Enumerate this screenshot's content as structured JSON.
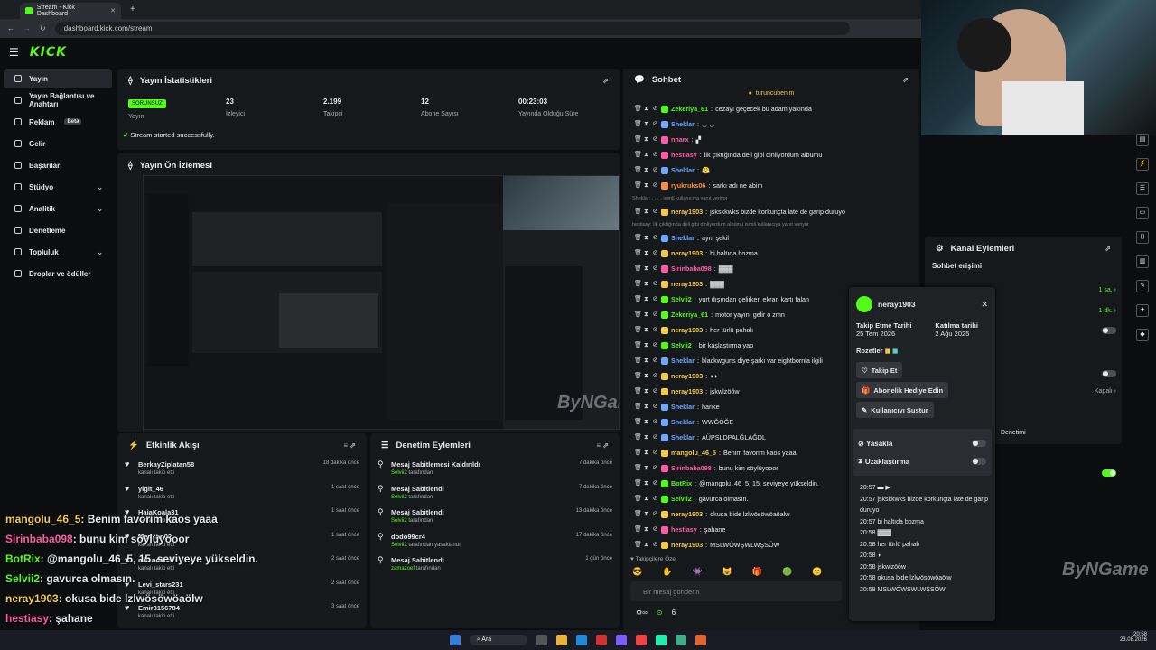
{
  "browser": {
    "tab_title": "Stream - Kick Dashboard",
    "url": "dashboard.kick.com/stream"
  },
  "brand": {
    "logo": "KICK",
    "accent": "#53fc18"
  },
  "sidebar": {
    "items": [
      {
        "label": "Yayın",
        "icon": "broadcast-icon",
        "active": true
      },
      {
        "label": "Yayın Bağlantısı ve Anahtarı",
        "icon": "link-icon"
      },
      {
        "label": "Reklam",
        "icon": "ad-icon",
        "badge": "Beta"
      },
      {
        "label": "Gelir",
        "icon": "money-icon"
      },
      {
        "label": "Başarılar",
        "icon": "trophy-icon"
      },
      {
        "label": "Stüdyo",
        "icon": "studio-icon",
        "chevron": true
      },
      {
        "label": "Analitik",
        "icon": "chart-icon",
        "chevron": true
      },
      {
        "label": "Denetleme",
        "icon": "shield-icon"
      },
      {
        "label": "Topluluk",
        "icon": "community-icon",
        "chevron": true
      },
      {
        "label": "Droplar ve ödüller",
        "icon": "gift-icon"
      }
    ]
  },
  "stats": {
    "title": "Yayın İstatistikleri",
    "status": "SORUNSUZ",
    "status_label": "Yayın",
    "items": [
      {
        "value": "23",
        "label": "İzleyici"
      },
      {
        "value": "2.199",
        "label": "Takipçi"
      },
      {
        "value": "12",
        "label": "Abone Sayısı"
      },
      {
        "value": "00:23:03",
        "label": "Yayında Olduğu Süre"
      }
    ],
    "message": "Stream started successfully."
  },
  "preview": {
    "title": "Yayın Ön İzlemesi",
    "watermark": "ByNGame"
  },
  "activity": {
    "title": "Etkinlik Akışı",
    "items": [
      {
        "name": "BerkayZiplatan58",
        "sub": "kanalı takip etti",
        "time": "18 dakika önce"
      },
      {
        "name": "yigit_46",
        "sub": "kanalı takip etti",
        "time": "1 saat önce"
      },
      {
        "name": "HaiaKoala31",
        "sub": "kanalı takip etti",
        "time": "1 saat önce"
      },
      {
        "name": "Mertcan02",
        "sub": "kanalı takip etti",
        "time": "1 saat önce"
      },
      {
        "name": "milandadd",
        "sub": "kanalı takip etti",
        "time": "2 saat önce"
      },
      {
        "name": "Levi_stars231",
        "sub": "kanalı takip etti",
        "time": "2 saat önce"
      },
      {
        "name": "Emir3156784",
        "sub": "kanalı takip etti",
        "time": "3 saat önce"
      }
    ]
  },
  "mod": {
    "title": "Denetim Eylemleri",
    "items": [
      {
        "title": "Mesaj Sabitlemesi Kaldırıldı",
        "by": "Selvii2",
        "sub": "tarafından",
        "time": "7 dakika önce"
      },
      {
        "title": "Mesaj Sabitlendi",
        "by": "Selvii2",
        "sub": "tarafından",
        "time": "7 dakika önce"
      },
      {
        "title": "Mesaj Sabitlendi",
        "by": "Selvii2",
        "sub": "tarafından",
        "time": "13 dakika önce"
      },
      {
        "title": "dodo99cr4",
        "by": "Selvii2",
        "sub": "tarafından yasaklandı",
        "time": "17 dakika önce"
      },
      {
        "title": "Mesaj Sabitlendi",
        "by": "zamazoef",
        "sub": "tarafından",
        "time": "1 gün önce"
      }
    ]
  },
  "chat": {
    "title": "Sohbet",
    "pinned_user": "turuncubenim",
    "input_placeholder": "Bir mesaj gönderin",
    "followers_only": "Takipçilere Özel",
    "viewer_count": "6",
    "messages": [
      {
        "user": "Zekeriya_61",
        "color": "#53fc18",
        "text": "cezayı geçecek bu adam yakında"
      },
      {
        "user": "Sheklar",
        "color": "#6fa8ff",
        "text": "◡ ◡"
      },
      {
        "user": "nnarx",
        "color": "#ff5aa5",
        "text": "▞"
      },
      {
        "user": "hestiasy",
        "color": "#ff5aa5",
        "text": "ilk çıktığında deli gibi dinliyordum albümü"
      },
      {
        "user": "Sheklar",
        "color": "#6fa8ff",
        "text": "😤"
      },
      {
        "user": "ryukruks06",
        "color": "#ff8c3a",
        "text": "sarkı adı ne abim"
      },
      {
        "sys": "Sheklar: ◡ ◡ isimli kullanıcıya yanıt veriyor"
      },
      {
        "user": "neray1903",
        "color": "#f2c94c",
        "text": "jskskkwks bizde korkunçta late de garip duruyo"
      },
      {
        "sys": "hestiasy: ilk çıktığında deli gibi dinliyordum albümü isimli kullanıcıya yanıt veriyor"
      },
      {
        "user": "Sheklar",
        "color": "#6fa8ff",
        "text": "aynı şekil"
      },
      {
        "user": "neray1903",
        "color": "#f2c94c",
        "text": "bi haltıda bozma"
      },
      {
        "user": "Sirinbaba098",
        "color": "#ff5aa5",
        "text": "▓▓▓"
      },
      {
        "user": "neray1903",
        "color": "#f2c94c",
        "text": "▓▓▓"
      },
      {
        "user": "Selvii2",
        "color": "#53fc18",
        "text": "yurt dışından gelirken ekran kartı falan"
      },
      {
        "user": "Zekeriya_61",
        "color": "#53fc18",
        "text": "motor yayını gelir o zmn"
      },
      {
        "user": "neray1903",
        "color": "#f2c94c",
        "text": "her türlü pahalı"
      },
      {
        "user": "Selvii2",
        "color": "#53fc18",
        "text": "bir kaşlaştırma yap"
      },
      {
        "user": "Sheklar",
        "color": "#6fa8ff",
        "text": "blackwguns diye şarkı var eightbornla ilgili"
      },
      {
        "user": "neray1903",
        "color": "#f2c94c",
        "text": "◗◗"
      },
      {
        "user": "neray1903",
        "color": "#f2c94c",
        "text": "jskwlzöõw"
      },
      {
        "user": "Sheklar",
        "color": "#6fa8ff",
        "text": "harike"
      },
      {
        "user": "Sheklar",
        "color": "#6fa8ff",
        "text": "WWĞÖĞE"
      },
      {
        "user": "Sheklar",
        "color": "#6fa8ff",
        "text": "AÜPSLDPALĞLAĞDL"
      },
      {
        "user": "mangolu_46_5",
        "color": "#f2c94c",
        "text": "Benim favorim kaos yaaa"
      },
      {
        "user": "Sirinbaba098",
        "color": "#ff5aa5",
        "text": "bunu kim söylüyooor"
      },
      {
        "user": "BotRix",
        "color": "#53fc18",
        "text": "@mangolu_46_5, 15. seviyeye yükseldin."
      },
      {
        "user": "Selvii2",
        "color": "#53fc18",
        "text": "gavurca olmasın."
      },
      {
        "user": "neray1903",
        "color": "#f2c94c",
        "text": "okusa bide lzlwösöwöaöalw"
      },
      {
        "user": "hestiasy",
        "color": "#ff5aa5",
        "text": "şahane"
      },
      {
        "user": "neray1903",
        "color": "#f2c94c",
        "text": "MSLWÖWŞWLWŞSÖW"
      }
    ]
  },
  "overlay": [
    {
      "user": "mangolu_46_5",
      "color": "#f2c94c",
      "text": ": Benim favorim kaos yaaa"
    },
    {
      "user": "Sirinbaba098",
      "color": "#ff5aa5",
      "text": ": bunu kim söylüyooor"
    },
    {
      "user": "BotRix",
      "color": "#53fc18",
      "text": ": @mangolu_46_5, 15. seviyeye yükseldin."
    },
    {
      "user": "Selvii2",
      "color": "#53fc18",
      "text": ": gavurca olmasın."
    },
    {
      "user": "neray1903",
      "color": "#f2c94c",
      "text": ": okusa bide lzlwösöwöaölw"
    },
    {
      "user": "hestiasy",
      "color": "#ff5aa5",
      "text": ": şahane"
    },
    {
      "user": "neray1903",
      "color": "#f2c94c",
      "text": ": MSLWÖWŞWLWŞSÖW"
    }
  ],
  "channel_actions": {
    "title": "Kanal Eylemleri",
    "chat_access": "Sohbet erişimi",
    "values": [
      "1 sa.",
      "1 dk.",
      "Kapalı"
    ],
    "label_denetimi": "Denetimi"
  },
  "user_card": {
    "name": "neray1903",
    "follow_date_label": "Takip Etme Tarihi",
    "follow_date": "25 Tem 2026",
    "join_date_label": "Katılma tarihi",
    "join_date": "2 Ağu 2025",
    "badges_label": "Rozetler",
    "follow_btn": "Takip Et",
    "gift_btn": "Abonelik Hediye Edin",
    "mute_btn": "Kullanıcıyı Sustur",
    "ban_label": "Yasakla",
    "timeout_label": "Uzaklaştırma",
    "history": [
      {
        "time": "20:57",
        "text": "▬ ▶"
      },
      {
        "time": "20:57",
        "text": "jskskkwks bizde korkunçta late de garip duruyo"
      },
      {
        "time": "20:57",
        "text": "bi haltıda bozma"
      },
      {
        "time": "20:58",
        "text": "▓▓▓"
      },
      {
        "time": "20:58",
        "text": "her türlü pahalı"
      },
      {
        "time": "20:58",
        "text": "◗"
      },
      {
        "time": "20:58",
        "text": "jskwlzöõw"
      },
      {
        "time": "20:58",
        "text": "okusa bide lzlwösöwöaölw"
      },
      {
        "time": "20:58",
        "text": "MSLWÖWŞWLWŞSÖW"
      }
    ]
  },
  "taskbar": {
    "search": "Ara",
    "time": "20:58",
    "date": "23.08.2026"
  },
  "watermark": "ByNGame"
}
